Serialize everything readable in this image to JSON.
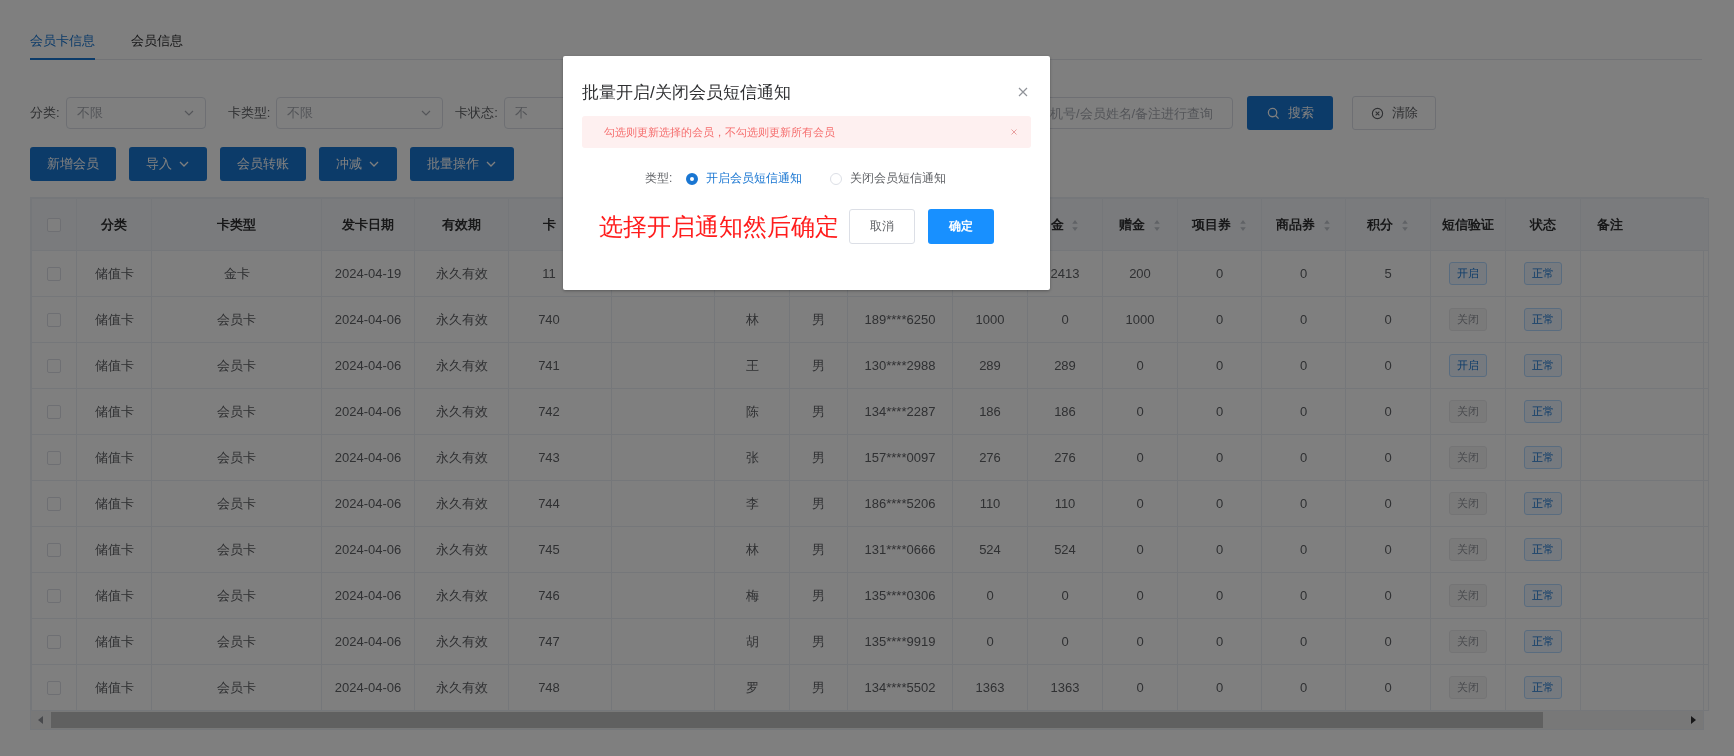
{
  "tabs": [
    {
      "label": "会员卡信息",
      "selected": true
    },
    {
      "label": "会员信息",
      "selected": false
    }
  ],
  "filters": [
    {
      "label": "分类:",
      "placeholder": "不限"
    },
    {
      "label": "卡类型:",
      "placeholder": "不限"
    },
    {
      "label": "卡状态:",
      "placeholder": "不"
    }
  ],
  "search": {
    "placeholder": "机号/会员姓名/备注进行查询"
  },
  "search_button": "搜索",
  "clear_button": "清除",
  "actions": [
    {
      "label": "新增会员",
      "dropdown": false
    },
    {
      "label": "导入",
      "dropdown": true
    },
    {
      "label": "会员转账",
      "dropdown": false
    },
    {
      "label": "冲减",
      "dropdown": true
    },
    {
      "label": "批量操作",
      "dropdown": true
    }
  ],
  "table": {
    "select_all_checked": false,
    "columns": [
      {
        "label": "分类",
        "kind": "text"
      },
      {
        "label": "卡类型",
        "kind": "text"
      },
      {
        "label": "发卡日期",
        "kind": "text"
      },
      {
        "label": "有效期",
        "kind": "text"
      },
      {
        "label": "卡",
        "kind": "text"
      },
      null,
      {
        "kind": "text"
      },
      {
        "kind": "text"
      },
      {
        "kind": "text"
      },
      {
        "kind": "text"
      },
      {
        "label": "金",
        "kind": "sortable"
      },
      {
        "label": "赠金",
        "kind": "sortable"
      },
      {
        "label": "项目券",
        "kind": "sortable"
      },
      {
        "label": "商品券",
        "kind": "sortable"
      },
      {
        "label": "积分",
        "kind": "sortable"
      },
      {
        "label": "短信验证",
        "kind": "sms"
      },
      {
        "label": "状态",
        "kind": "status"
      },
      {
        "label": "备注",
        "kind": "text"
      }
    ],
    "rows": [
      {
        "checked": false,
        "cells": [
          "储值卡",
          "金卡",
          "2024-04-19",
          "永久有效",
          "11",
          null,
          null,
          null,
          null,
          null,
          "2413",
          "200",
          "0",
          "0",
          "5",
          {
            "text": "开启",
            "on": true
          },
          {
            "text": "正常"
          },
          null
        ]
      },
      {
        "checked": false,
        "cells": [
          "储值卡",
          "会员卡",
          "2024-04-06",
          "永久有效",
          "740",
          null,
          "林",
          "男",
          "189****6250",
          "1000",
          "0",
          "1000",
          "0",
          "0",
          "0",
          {
            "text": "关闭",
            "on": false
          },
          {
            "text": "正常"
          },
          null
        ]
      },
      {
        "checked": false,
        "cells": [
          "储值卡",
          "会员卡",
          "2024-04-06",
          "永久有效",
          "741",
          null,
          "王",
          "男",
          "130****2988",
          "289",
          "289",
          "0",
          "0",
          "0",
          "0",
          {
            "text": "开启",
            "on": true
          },
          {
            "text": "正常"
          },
          null
        ]
      },
      {
        "checked": false,
        "cells": [
          "储值卡",
          "会员卡",
          "2024-04-06",
          "永久有效",
          "742",
          null,
          "陈",
          "男",
          "134****2287",
          "186",
          "186",
          "0",
          "0",
          "0",
          "0",
          {
            "text": "关闭",
            "on": false
          },
          {
            "text": "正常"
          },
          null
        ]
      },
      {
        "checked": false,
        "cells": [
          "储值卡",
          "会员卡",
          "2024-04-06",
          "永久有效",
          "743",
          null,
          "张",
          "男",
          "157****0097",
          "276",
          "276",
          "0",
          "0",
          "0",
          "0",
          {
            "text": "关闭",
            "on": false
          },
          {
            "text": "正常"
          },
          null
        ]
      },
      {
        "checked": false,
        "cells": [
          "储值卡",
          "会员卡",
          "2024-04-06",
          "永久有效",
          "744",
          null,
          "李",
          "男",
          "186****5206",
          "110",
          "110",
          "0",
          "0",
          "0",
          "0",
          {
            "text": "关闭",
            "on": false
          },
          {
            "text": "正常"
          },
          null
        ]
      },
      {
        "checked": false,
        "cells": [
          "储值卡",
          "会员卡",
          "2024-04-06",
          "永久有效",
          "745",
          null,
          "林",
          "男",
          "131****0666",
          "524",
          "524",
          "0",
          "0",
          "0",
          "0",
          {
            "text": "关闭",
            "on": false
          },
          {
            "text": "正常"
          },
          null
        ]
      },
      {
        "checked": false,
        "cells": [
          "储值卡",
          "会员卡",
          "2024-04-06",
          "永久有效",
          "746",
          null,
          "梅",
          "男",
          "135****0306",
          "0",
          "0",
          "0",
          "0",
          "0",
          "0",
          {
            "text": "关闭",
            "on": false
          },
          {
            "text": "正常"
          },
          null
        ]
      },
      {
        "checked": false,
        "cells": [
          "储值卡",
          "会员卡",
          "2024-04-06",
          "永久有效",
          "747",
          null,
          "胡",
          "男",
          "135****9919",
          "0",
          "0",
          "0",
          "0",
          "0",
          "0",
          {
            "text": "关闭",
            "on": false
          },
          {
            "text": "正常"
          },
          null
        ]
      },
      {
        "checked": false,
        "cells": [
          "储值卡",
          "会员卡",
          "2024-04-06",
          "永久有效",
          "748",
          null,
          "罗",
          "男",
          "134****5502",
          "1363",
          "1363",
          "0",
          "0",
          "0",
          "0",
          {
            "text": "关闭",
            "on": false
          },
          {
            "text": "正常"
          },
          null
        ]
      }
    ]
  },
  "dialog": {
    "title": "批量开启/关闭会员短信通知",
    "alert": "勾选则更新选择的会员，不勾选则更新所有会员",
    "type_label": "类型:",
    "options": [
      {
        "label": "开启会员短信通知",
        "selected": true
      },
      {
        "label": "关闭会员短信通知",
        "selected": false
      }
    ],
    "annotation": "选择开启通知然后确定",
    "cancel": "取消",
    "confirm": "确定"
  }
}
